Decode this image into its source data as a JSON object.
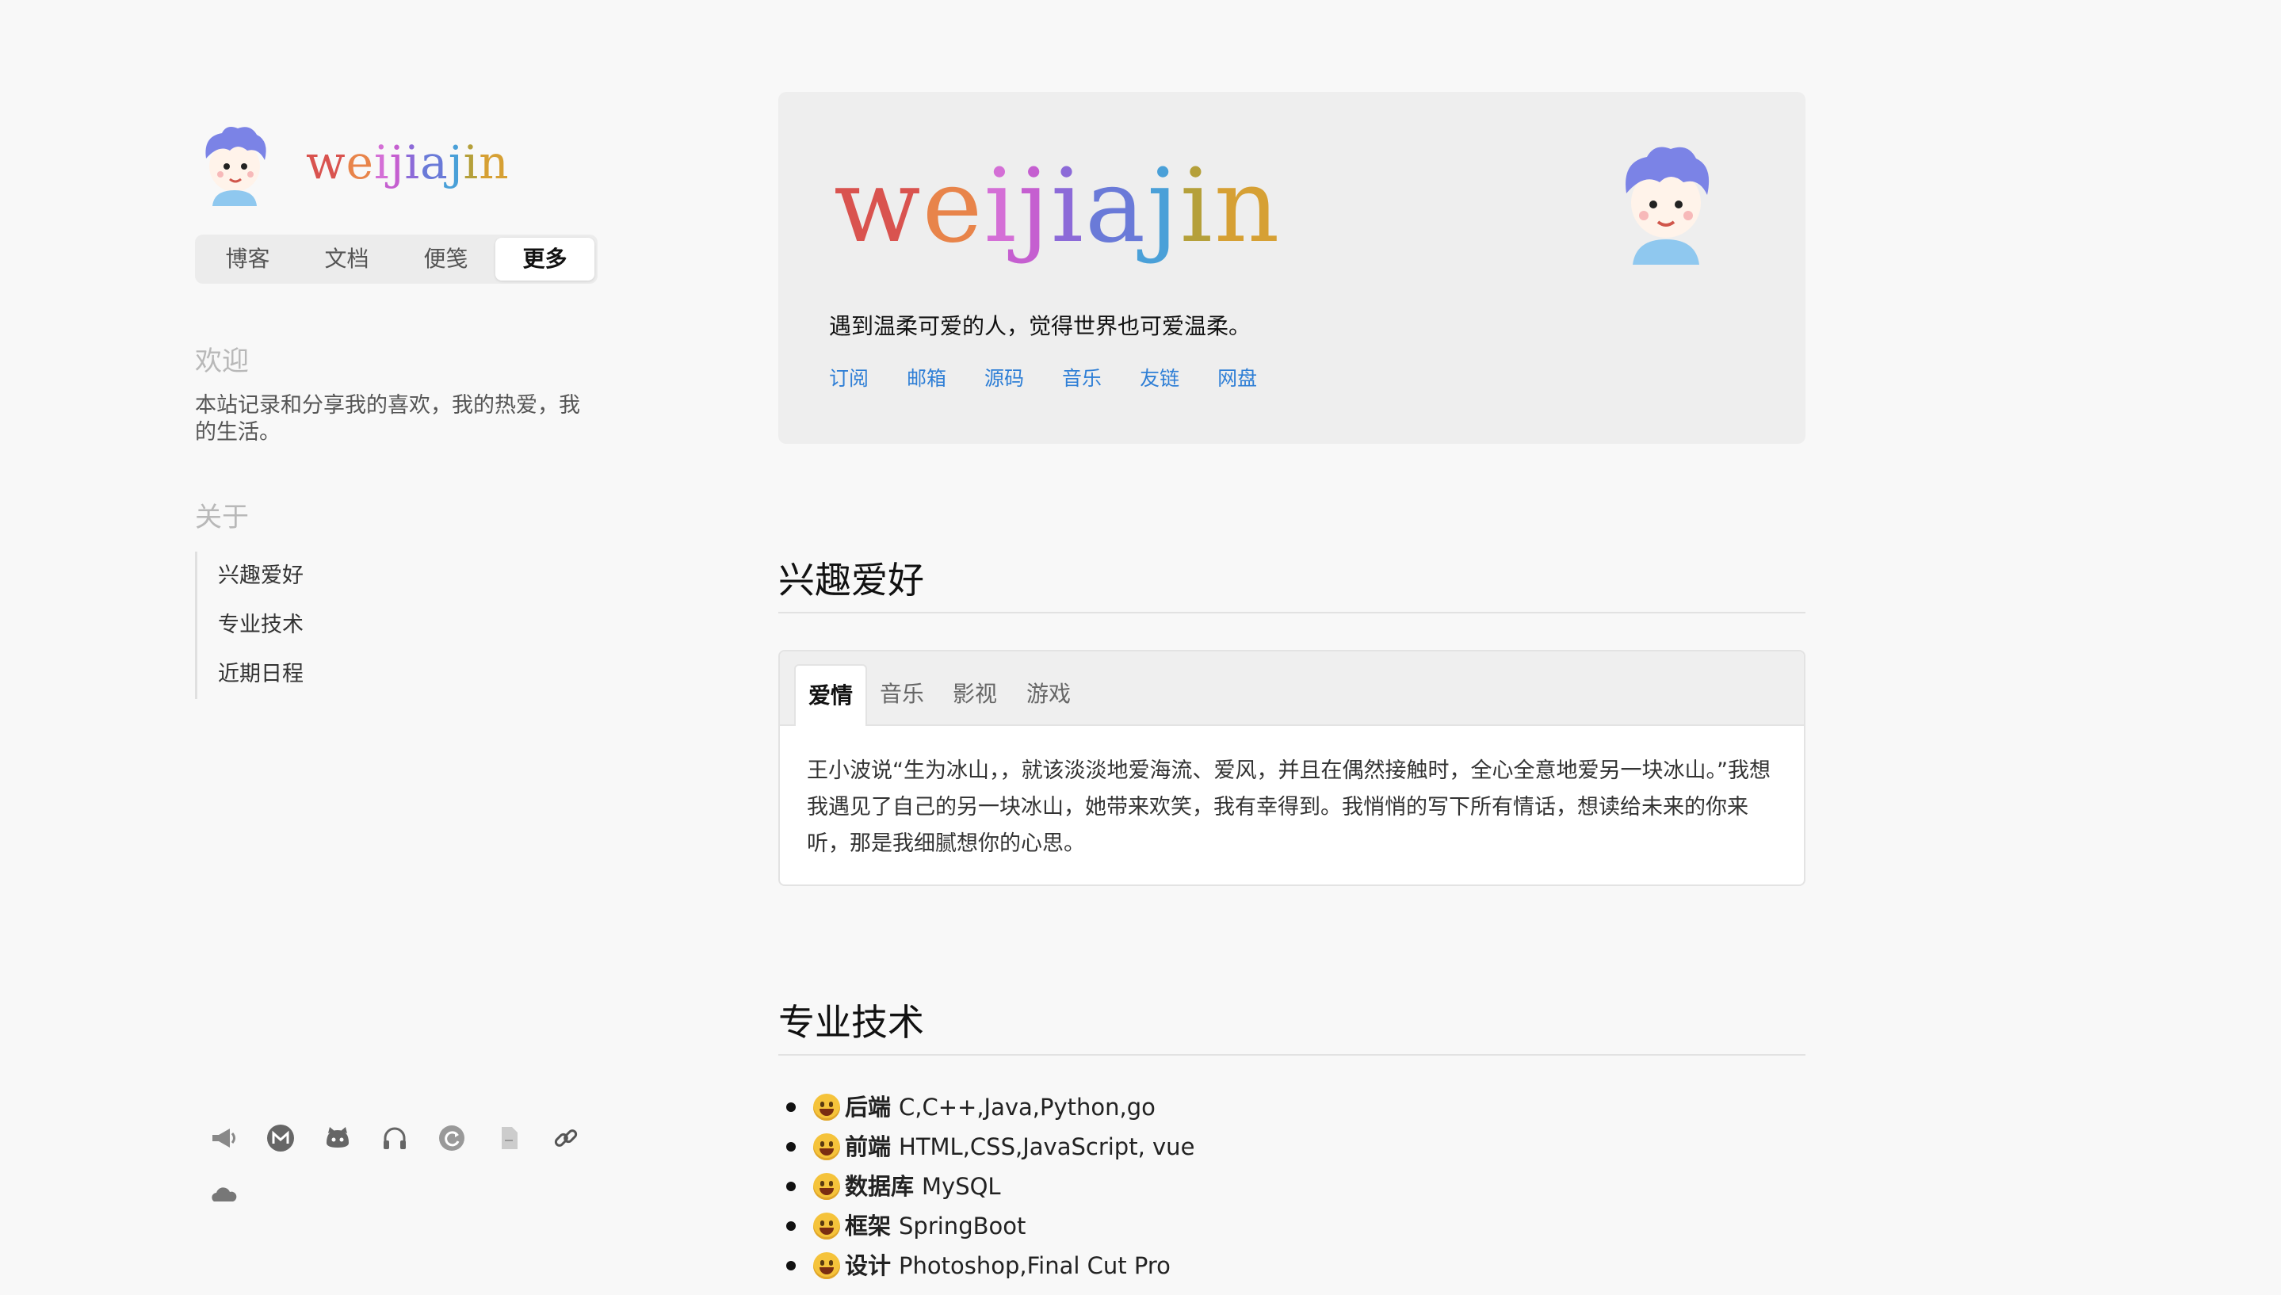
{
  "site": {
    "name_letters": [
      "w",
      "e",
      "i",
      "j",
      "i",
      "a",
      "j",
      "i",
      "n"
    ],
    "name_colors": [
      "#d9534f",
      "#e8844a",
      "#d46fd6",
      "#c55fd0",
      "#8c6ad8",
      "#6a7ad8",
      "#4aa0d8",
      "#b5a03a",
      "#d6a034"
    ]
  },
  "nav": {
    "items": [
      {
        "label": "博客"
      },
      {
        "label": "文档"
      },
      {
        "label": "便笺"
      },
      {
        "label": "更多"
      }
    ],
    "active": "更多"
  },
  "sidebar": {
    "welcome_heading": "欢迎",
    "welcome_text": "本站记录和分享我的喜欢，我的热爱，我的生活。",
    "about_heading": "关于",
    "toc": [
      {
        "label": "兴趣爱好"
      },
      {
        "label": "专业技术"
      },
      {
        "label": "近期日程"
      }
    ],
    "social_icons": [
      "megaphone-icon",
      "gmail-icon",
      "github-icon",
      "headphones-icon",
      "refresh-icon",
      "document-icon",
      "link-icon",
      "cloud-icon"
    ]
  },
  "hero": {
    "motto": "遇到温柔可爱的人，觉得世界也可爱温柔。",
    "links": [
      {
        "label": "订阅"
      },
      {
        "label": "邮箱"
      },
      {
        "label": "源码"
      },
      {
        "label": "音乐"
      },
      {
        "label": "友链"
      },
      {
        "label": "网盘"
      }
    ]
  },
  "hobbies": {
    "title": "兴趣爱好",
    "tabs": [
      {
        "label": "爱情"
      },
      {
        "label": "音乐"
      },
      {
        "label": "影视"
      },
      {
        "label": "游戏"
      }
    ],
    "active_tab": "爱情",
    "content": "王小波说“生为冰山，，就该淡淡地爱海流、爱风，并且在偶然接触时，全心全意地爱另一块冰山。”我想我遇见了自己的另一块冰山，她带来欢笑，我有幸得到。我悄悄的写下所有情话，想读给未来的你来听，那是我细腻想你的心思。"
  },
  "skills": {
    "title": "专业技术",
    "items": [
      {
        "label": "后端",
        "value": "C,C++,Java,Python,go"
      },
      {
        "label": "前端",
        "value": "HTML,CSS,JavaScript, vue"
      },
      {
        "label": "数据库",
        "value": "MySQL"
      },
      {
        "label": "框架",
        "value": "SpringBoot"
      },
      {
        "label": "设计",
        "value": "Photoshop,Final Cut Pro"
      }
    ]
  },
  "colors": {
    "link": "#2f7fd6",
    "avatar_hair": "#7b83e6",
    "avatar_shirt": "#8fc8ef"
  }
}
